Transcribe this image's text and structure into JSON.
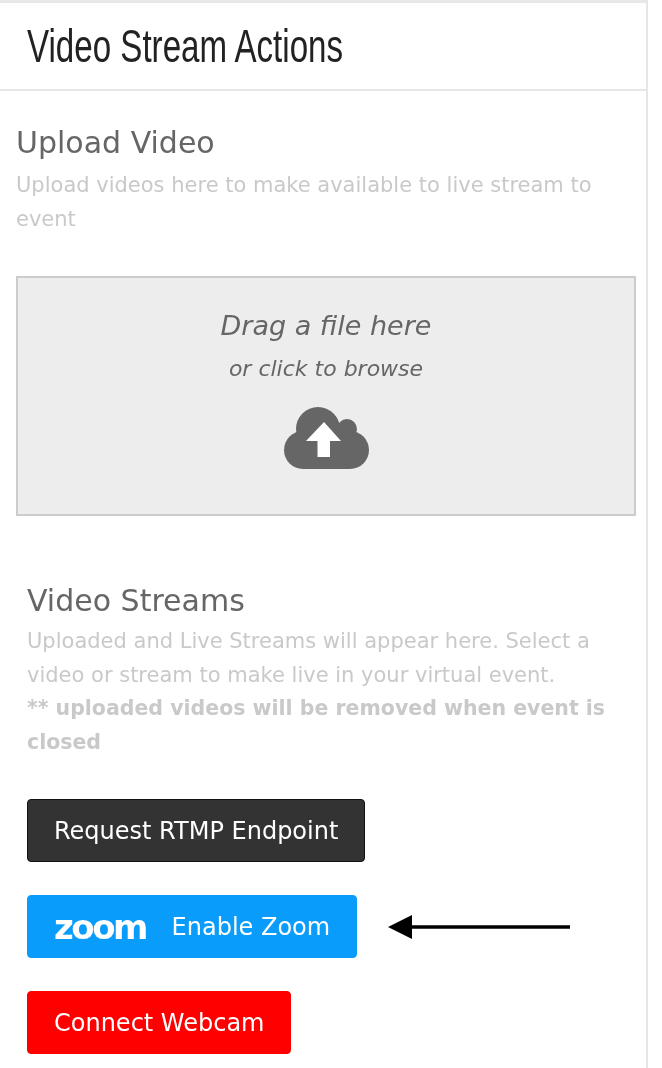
{
  "panel": {
    "title": "Video Stream Actions"
  },
  "upload": {
    "heading": "Upload Video",
    "description": "Upload videos here to make available to live stream to event",
    "dropzone": {
      "primary": "Drag a file here",
      "secondary": "or click to browse"
    }
  },
  "streams": {
    "heading": "Video Streams",
    "description": "Uploaded and Live Streams will appear here. Select a video or stream to make live in your virtual event.",
    "note": "** uploaded videos will be removed when event is closed"
  },
  "buttons": [
    {
      "kind": "dark",
      "label": "Request RTMP Endpoint",
      "annotated": false
    },
    {
      "kind": "zoom",
      "logo": "zoom",
      "label": "Enable Zoom",
      "annotated": true
    },
    {
      "kind": "danger",
      "label": "Connect Webcam",
      "annotated": false
    }
  ]
}
